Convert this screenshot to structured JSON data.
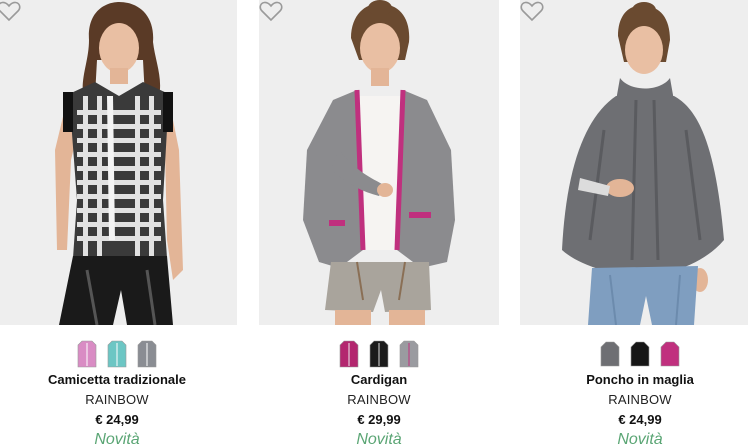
{
  "products": [
    {
      "name": "Camicetta tradizionale",
      "brand": "RAINBOW",
      "price": "€ 24,99",
      "badge": "Novità",
      "image_subject": "woman in black and white gingham sleeveless blouse and black leather trousers",
      "swatches": [
        {
          "color": "#d98cc4",
          "label": "pink"
        },
        {
          "color": "#6cc6c4",
          "label": "turquoise"
        },
        {
          "color": "#8a8d93",
          "label": "grey"
        }
      ]
    },
    {
      "name": "Cardigan",
      "brand": "RAINBOW",
      "price": "€ 29,99",
      "badge": "Novità",
      "image_subject": "woman in grey knit cardigan with magenta trim over white top and grey lederhosen shorts",
      "swatches": [
        {
          "color": "#b3276f",
          "label": "magenta"
        },
        {
          "color": "#1b1b1b",
          "label": "black"
        },
        {
          "color": "#9a9ba0",
          "label": "grey"
        }
      ]
    },
    {
      "name": "Poncho in maglia",
      "brand": "RAINBOW",
      "price": "€ 24,99",
      "badge": "Novità",
      "image_subject": "woman in grey cable-knit turtleneck poncho and blue jeans",
      "swatches": [
        {
          "color": "#6e6f73",
          "label": "grey"
        },
        {
          "color": "#161616",
          "label": "black"
        },
        {
          "color": "#c0307e",
          "label": "magenta"
        }
      ]
    }
  ],
  "colors": {
    "badge": "#5aa574",
    "photo_bg": "#eeeeee",
    "heart_stroke": "#9a9a9a"
  },
  "icons": {
    "wishlist": "heart-outline-icon",
    "swatch": "garment-swatch-icon"
  }
}
